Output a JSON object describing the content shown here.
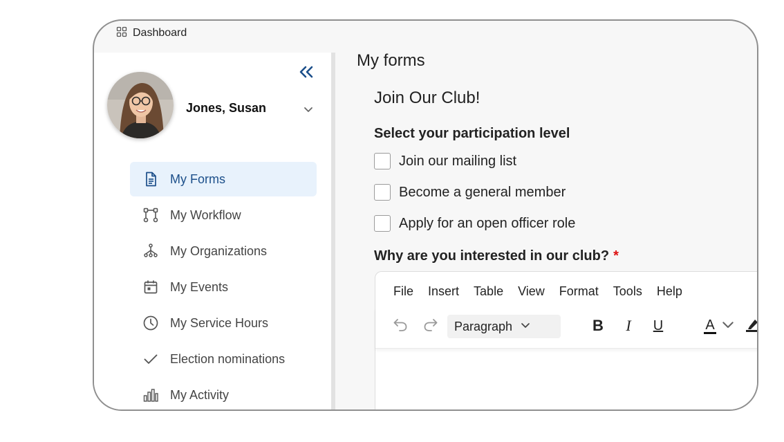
{
  "topbar": {
    "label": "Dashboard",
    "icon": "grid-icon"
  },
  "sidebar": {
    "collapse_icon": "double-chevron-left-icon",
    "user": {
      "name": "Jones, Susan",
      "menu_icon": "chevron-down-icon"
    },
    "items": [
      {
        "label": "My Forms",
        "icon": "document-icon",
        "active": true
      },
      {
        "label": "My Workflow",
        "icon": "workflow-icon",
        "active": false
      },
      {
        "label": "My Organizations",
        "icon": "organizations-icon",
        "active": false
      },
      {
        "label": "My Events",
        "icon": "calendar-icon",
        "active": false
      },
      {
        "label": "My Service Hours",
        "icon": "clock-icon",
        "active": false
      },
      {
        "label": "Election nominations",
        "icon": "checkmark-icon",
        "active": false
      },
      {
        "label": "My Activity",
        "icon": "bar-chart-icon",
        "active": false
      }
    ]
  },
  "main": {
    "page_title": "My forms",
    "form_title": "Join Our Club!",
    "participation": {
      "label": "Select your participation level",
      "options": [
        {
          "label": "Join our mailing list",
          "checked": false
        },
        {
          "label": "Become a general member",
          "checked": false
        },
        {
          "label": "Apply for an open officer role",
          "checked": false
        }
      ]
    },
    "interest_question": {
      "label": "Why are you interested in our club?",
      "required_mark": "*"
    },
    "editor": {
      "menu": [
        "File",
        "Insert",
        "Table",
        "View",
        "Format",
        "Tools",
        "Help"
      ],
      "block_format": "Paragraph",
      "bold": "B",
      "italic": "I",
      "underline": "U",
      "text_color": "A"
    }
  },
  "colors": {
    "accent": "#1c4f8a",
    "active_bg": "#e8f2fc",
    "required": "#dd1111"
  }
}
